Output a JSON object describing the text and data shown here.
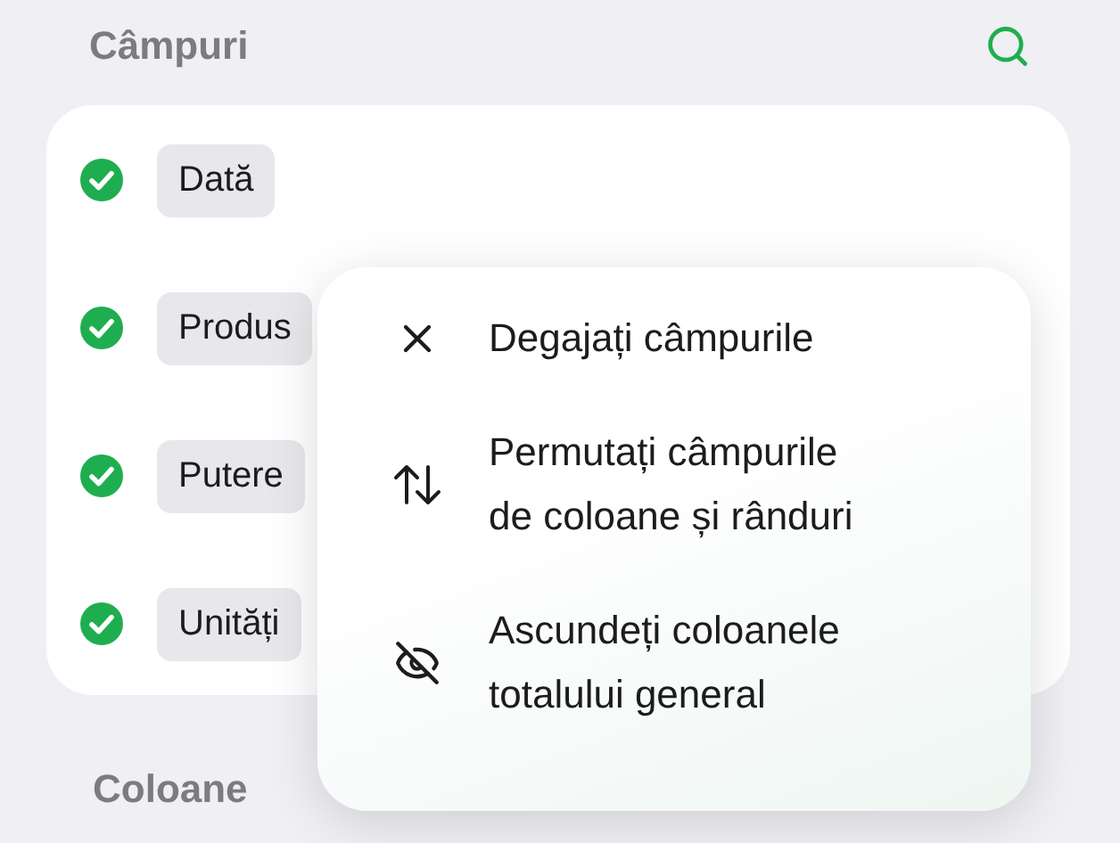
{
  "section_title": "Câmpuri",
  "fields": [
    {
      "label": "Dată",
      "checked": true
    },
    {
      "label": "Produs",
      "checked": true
    },
    {
      "label": "Putere",
      "checked": true
    },
    {
      "label": "Unități",
      "checked": true
    }
  ],
  "next_section_title": "Coloane",
  "menu": {
    "items": [
      {
        "kind": "remove",
        "lines": [
          "Degajați câmpurile"
        ]
      },
      {
        "kind": "swap",
        "lines": [
          "Permutați câmpurile",
          "de coloane și rânduri"
        ]
      },
      {
        "kind": "hide",
        "lines": [
          "Ascundeți coloanele",
          "totalului general"
        ]
      }
    ]
  }
}
